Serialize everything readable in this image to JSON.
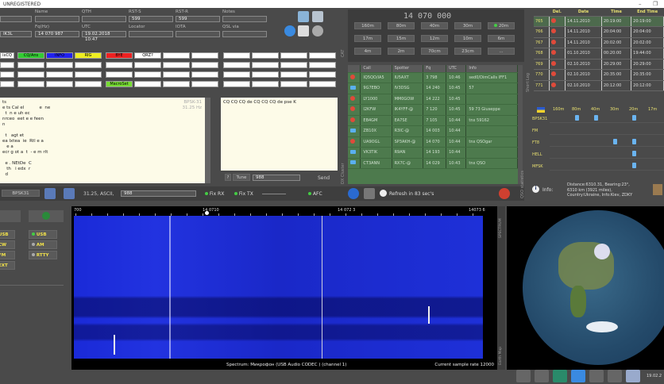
{
  "title": "UNREGISTERED",
  "qso": {
    "fields": [
      {
        "label": "Name",
        "value": ""
      },
      {
        "label": "QTH",
        "value": ""
      },
      {
        "label": "RST-S",
        "value": "599"
      },
      {
        "label": "RST-R",
        "value": "599"
      },
      {
        "label": "Notes",
        "value": ""
      }
    ],
    "fields2": [
      {
        "label": "Fq(Hz)",
        "value": "14 070 987"
      },
      {
        "label": "UTC",
        "value": "19.02.2018 10:47"
      },
      {
        "label": "Locator",
        "value": ""
      },
      {
        "label": "IOTA",
        "value": ""
      },
      {
        "label": "QSL via",
        "value": ""
      }
    ],
    "call_value": "IK3L"
  },
  "macros": [
    "ixCQ",
    "CQ/Ans",
    "INFO",
    "RIG",
    "BYE",
    "QRZ?",
    "MacroSet"
  ],
  "rx_text": {
    "lines": [
      "ts",
      "e ts Cal el           e  ne",
      "  t  n e uh ec",
      "nrceo  eet e e feen",
      "n",
      "",
      "  t   agt et",
      "ea lxtea  ie  Rtl e a",
      "   e a",
      "ecr g ot a  t  - e m rlt",
      "",
      "  e . NEtDe  C",
      "   th   i edx  r",
      "  d"
    ],
    "mode_tag": "BPSK-31",
    "freq_tag": "31.25 Hz"
  },
  "tx_text": "CQ CQ CQ de CQ CQ CQ de pse K",
  "tx_controls": {
    "tune": "Tune",
    "value": "988",
    "send": "Send"
  },
  "toolbar": {
    "mode": "BPSK31",
    "rate": "31.25,",
    "encoding": "ASCII,",
    "value": "988",
    "fix_rx": "Fix RX",
    "fix_tx": "Fix TX",
    "afc": "AFC"
  },
  "freq_display": "14 070 000",
  "bands": [
    "160m",
    "80m",
    "40m",
    "30m",
    "20m",
    "17m",
    "15m",
    "12m",
    "10m",
    "6m",
    "4m",
    "2m",
    "70cm",
    "23cm",
    "..."
  ],
  "active_band": "20m",
  "spots": {
    "headers": [
      "",
      "Call",
      "Spotter",
      "Fq",
      "UTC",
      "Info"
    ],
    "rows": [
      {
        "src": "red",
        "call": "IQ5QO/IA5",
        "spotter": "IU5AXT",
        "fq": "3 798",
        "utc": "10:46",
        "info": "sed0/DimCalls IFF1"
      },
      {
        "src": "blue",
        "call": "9G7EBO",
        "spotter": "IV3DSG",
        "fq": "14 240",
        "utc": "10:45",
        "info": "57"
      },
      {
        "src": "red",
        "call": "LY1000",
        "spotter": "MM0GOW",
        "fq": "14 222",
        "utc": "10:45",
        "info": ""
      },
      {
        "src": "red",
        "call": "I2KFW",
        "spotter": "IK4YFF-@",
        "fq": "7 120",
        "utc": "10:45",
        "info": "59 73 Giuseppe"
      },
      {
        "src": "red",
        "call": "EB4GM",
        "spotter": "EA7SE",
        "fq": "7 105",
        "utc": "10:44",
        "info": "tnx 59162"
      },
      {
        "src": "blue",
        "call": "ZB10X",
        "spotter": "R3IC-@",
        "fq": "14 003",
        "utc": "10:44",
        "info": ""
      },
      {
        "src": "red",
        "call": "UA9OGL",
        "spotter": "SP3AKH-@",
        "fq": "14 070",
        "utc": "10:44",
        "info": "tnx QSOgar"
      },
      {
        "src": "blue",
        "call": "VK3TIK",
        "spotter": "R9AN",
        "fq": "14 193",
        "utc": "10:44",
        "info": ""
      },
      {
        "src": "blue",
        "call": "CT3ANN",
        "spotter": "RX7C-@",
        "fq": "14 029",
        "utc": "10:43",
        "info": "tnx QSO"
      }
    ]
  },
  "refresh": "Refresh in 83 sec's",
  "log": {
    "headers": [
      "",
      "Del.",
      "Date",
      "Time",
      "End Time"
    ],
    "rows": [
      {
        "n": "765",
        "date": "14.11.2010",
        "time": "20:19:00",
        "end": "20:19:00"
      },
      {
        "n": "766",
        "date": "14.11.2010",
        "time": "20:04:00",
        "end": "20:04:00"
      },
      {
        "n": "767",
        "date": "14.11.2010",
        "time": "20:02:00",
        "end": "20:02:00"
      },
      {
        "n": "768",
        "date": "01.10.2010",
        "time": "00:20:00",
        "end": "19:44:00"
      },
      {
        "n": "769",
        "date": "02.10.2010",
        "time": "20:29:00",
        "end": "20:29:00"
      },
      {
        "n": "770",
        "date": "02.10.2010",
        "time": "20:35:00",
        "end": "20:35:00"
      },
      {
        "n": "771",
        "date": "02.10.2010",
        "time": "20:12:00",
        "end": "20:12:00"
      }
    ]
  },
  "side_labels": {
    "log": "Short Log",
    "stats": "QSO statistics",
    "cat": "CAT",
    "cluster": "DX Cluster",
    "spectrum": "SPECTRUM",
    "earth": "Earth Map"
  },
  "matrix": {
    "bands": [
      "160m",
      "80m",
      "40m",
      "30m",
      "20m",
      "17m"
    ],
    "modes": [
      "BPSK31",
      "FM",
      "FT8",
      "HELL",
      "MFSK"
    ],
    "marks": [
      [
        0,
        1,
        1,
        0,
        1,
        0
      ],
      [
        0,
        0,
        0,
        0,
        0,
        0
      ],
      [
        0,
        0,
        0,
        1,
        1,
        0
      ],
      [
        0,
        0,
        0,
        0,
        1,
        0
      ],
      [
        0,
        0,
        0,
        0,
        1,
        0
      ]
    ]
  },
  "info": {
    "label": "Info:",
    "lines": [
      "Distance:6310.31, Bearing:23°,",
      "6310 km (3921 miles),",
      "Country:Ukraine, Info:Kiev, ZDKY"
    ]
  },
  "modes": {
    "left": [
      "USB",
      "CW",
      "FM",
      "EXT"
    ],
    "right": [
      "USB",
      "AM",
      "RTTY"
    ],
    "active": "USB"
  },
  "waterfall": {
    "ticks": [
      "700",
      "14 0710",
      "14 072 3",
      "14073 6"
    ],
    "source": "Spectrum: Микрофон (USB Audio CODEC ) (channel 1)",
    "rate": "Current sample rate 12000"
  },
  "clock": "19.02.2"
}
